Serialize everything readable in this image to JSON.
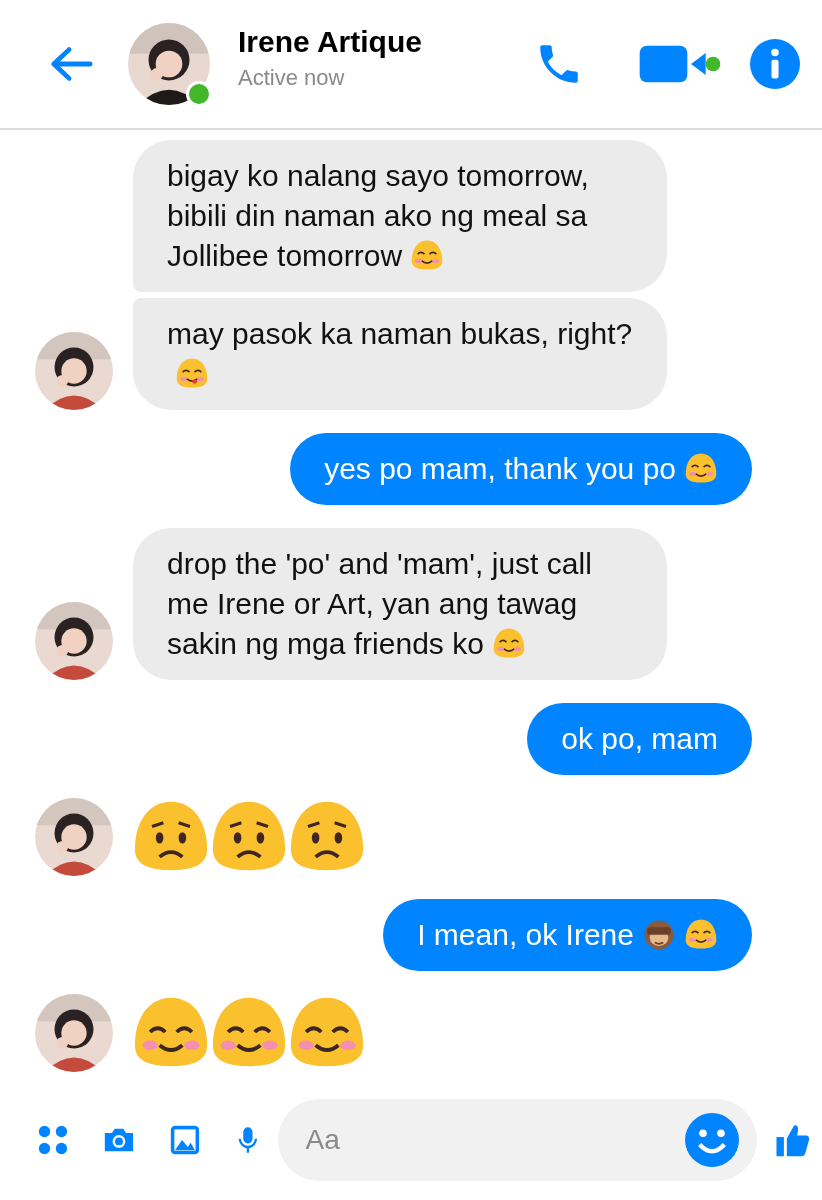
{
  "header": {
    "name": "Irene Artique",
    "status": "Active now",
    "online": true,
    "video_active": true
  },
  "messages": [
    {
      "kind": "received",
      "avatar": false,
      "text": "bigay ko nalang sayo tomorrow, bibili din naman ako ng meal sa Jollibee tomorrow",
      "emojis": [
        {
          "kind": "smile"
        }
      ]
    },
    {
      "kind": "received",
      "avatar": true,
      "text": "may pasok ka naman bukas, right?",
      "emojis": [
        {
          "kind": "yum"
        }
      ]
    },
    {
      "kind": "sent",
      "text": "yes po mam, thank you po",
      "emojis": [
        {
          "kind": "smile"
        }
      ]
    },
    {
      "kind": "received",
      "avatar": true,
      "text": "drop the 'po' and 'mam', just call me Irene or Art, yan ang tawag sakin ng mga friends ko",
      "emojis": [
        {
          "kind": "smile"
        }
      ]
    },
    {
      "kind": "sent",
      "text": "ok po, mam"
    },
    {
      "kind": "received",
      "avatar": true,
      "emojis": [
        {
          "kind": "worried"
        },
        {
          "kind": "worried"
        },
        {
          "kind": "worried"
        }
      ]
    },
    {
      "kind": "sent",
      "text": "I mean, ok Irene",
      "emojis": [
        {
          "kind": "monkey"
        },
        {
          "kind": "smile"
        }
      ]
    },
    {
      "kind": "received",
      "avatar": true,
      "emojis": [
        {
          "kind": "smile"
        },
        {
          "kind": "smile"
        },
        {
          "kind": "smile"
        }
      ]
    }
  ],
  "composer": {
    "placeholder": "Aa"
  }
}
